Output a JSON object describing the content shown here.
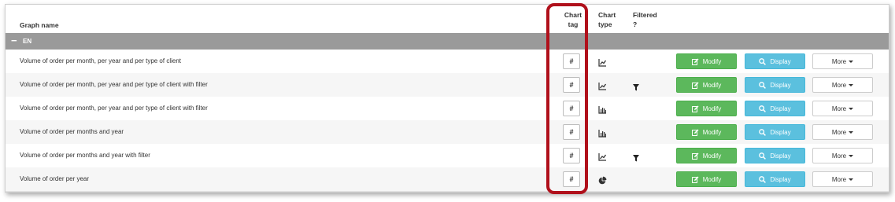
{
  "header": {
    "graph_name": "Graph name",
    "chart_tag": "Chart tag",
    "chart_type": "Chart type",
    "filtered": "Filtered ?"
  },
  "group": {
    "toggle": "−",
    "name": "EN"
  },
  "buttons": {
    "modify": "Modify",
    "display": "Display",
    "more": "More"
  },
  "rows": [
    {
      "name": "Volume of order per month, per year and per type of client",
      "tag": "#",
      "type_icon": "line-chart-icon",
      "filtered": false
    },
    {
      "name": "Volume of order per month, per year and per type of client with filter",
      "tag": "#",
      "type_icon": "line-chart-icon",
      "filtered": true
    },
    {
      "name": "Volume of order per month, per year and per type of client with filter",
      "tag": "#",
      "type_icon": "bar-chart-icon",
      "filtered": false
    },
    {
      "name": "Volume of order per months and year",
      "tag": "#",
      "type_icon": "bar-chart-icon",
      "filtered": false
    },
    {
      "name": "Volume of order per months and year with filter",
      "tag": "#",
      "type_icon": "line-chart-icon",
      "filtered": true
    },
    {
      "name": "Volume of order per year",
      "tag": "#",
      "type_icon": "pie-chart-icon",
      "filtered": false
    }
  ],
  "colors": {
    "modify": "#5cb85c",
    "display": "#5bc0de",
    "group_bar": "#9a9a9a",
    "highlight": "#b0101b"
  }
}
